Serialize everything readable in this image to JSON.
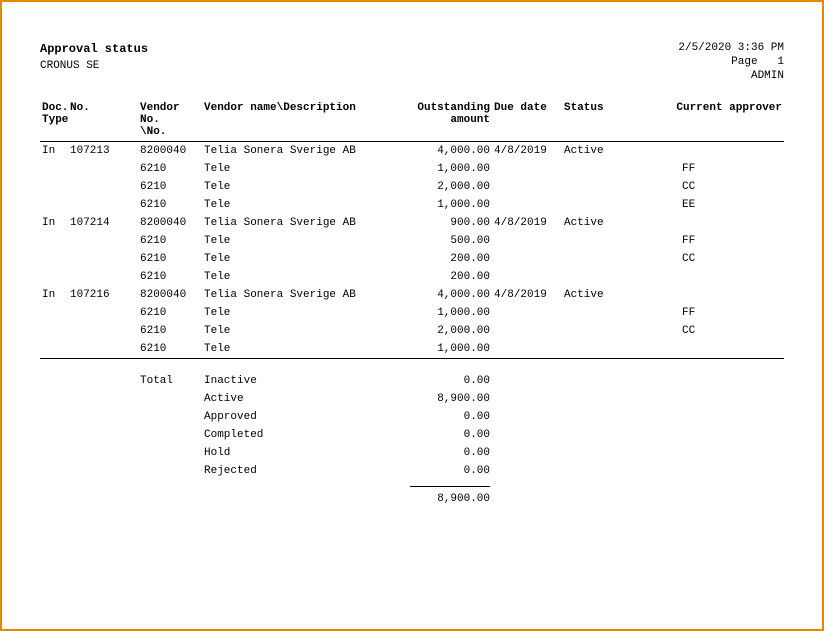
{
  "header": {
    "title": "Approval status",
    "company": "CRONUS SE",
    "datetime": "2/5/2020 3:36 PM",
    "page_label": "Page",
    "page_no": "1",
    "user": "ADMIN"
  },
  "columns": {
    "doc_type": "Doc.\nType",
    "no": "No.",
    "vendor_no": "Vendor No.\n\\No.",
    "desc": "Vendor name\\Description",
    "amount": "Outstanding\namount",
    "due": "Due date",
    "status": "Status",
    "approver": "Current approver"
  },
  "rows": [
    {
      "doc_type": "In",
      "no": "107213",
      "vendor": "8200040",
      "desc": "Telia Sonera Sverige AB",
      "amount": "4,000.00",
      "due": "4/8/2019",
      "status": "Active",
      "approver": ""
    },
    {
      "doc_type": "",
      "no": "",
      "vendor": "6210",
      "desc": "Tele",
      "amount": "1,000.00",
      "due": "",
      "status": "",
      "approver": "FF"
    },
    {
      "doc_type": "",
      "no": "",
      "vendor": "6210",
      "desc": "Tele",
      "amount": "2,000.00",
      "due": "",
      "status": "",
      "approver": "CC"
    },
    {
      "doc_type": "",
      "no": "",
      "vendor": "6210",
      "desc": "Tele",
      "amount": "1,000.00",
      "due": "",
      "status": "",
      "approver": "EE"
    },
    {
      "doc_type": "In",
      "no": "107214",
      "vendor": "8200040",
      "desc": "Telia Sonera Sverige AB",
      "amount": "900.00",
      "due": "4/8/2019",
      "status": "Active",
      "approver": ""
    },
    {
      "doc_type": "",
      "no": "",
      "vendor": "6210",
      "desc": "Tele",
      "amount": "500.00",
      "due": "",
      "status": "",
      "approver": "FF"
    },
    {
      "doc_type": "",
      "no": "",
      "vendor": "6210",
      "desc": "Tele",
      "amount": "200.00",
      "due": "",
      "status": "",
      "approver": "CC"
    },
    {
      "doc_type": "",
      "no": "",
      "vendor": "6210",
      "desc": "Tele",
      "amount": "200.00",
      "due": "",
      "status": "",
      "approver": ""
    },
    {
      "doc_type": "In",
      "no": "107216",
      "vendor": "8200040",
      "desc": "Telia Sonera Sverige AB",
      "amount": "4,000.00",
      "due": "4/8/2019",
      "status": "Active",
      "approver": ""
    },
    {
      "doc_type": "",
      "no": "",
      "vendor": "6210",
      "desc": "Tele",
      "amount": "1,000.00",
      "due": "",
      "status": "",
      "approver": "FF"
    },
    {
      "doc_type": "",
      "no": "",
      "vendor": "6210",
      "desc": "Tele",
      "amount": "2,000.00",
      "due": "",
      "status": "",
      "approver": "CC"
    },
    {
      "doc_type": "",
      "no": "",
      "vendor": "6210",
      "desc": "Tele",
      "amount": "1,000.00",
      "due": "",
      "status": "",
      "approver": ""
    }
  ],
  "totals": {
    "label": "Total",
    "lines": [
      {
        "label": "Inactive",
        "amount": "0.00"
      },
      {
        "label": "Active",
        "amount": "8,900.00"
      },
      {
        "label": "Approved",
        "amount": "0.00"
      },
      {
        "label": "Completed",
        "amount": "0.00"
      },
      {
        "label": "Hold",
        "amount": "0.00"
      },
      {
        "label": "Rejected",
        "amount": "0.00"
      }
    ],
    "grand": "8,900.00"
  }
}
